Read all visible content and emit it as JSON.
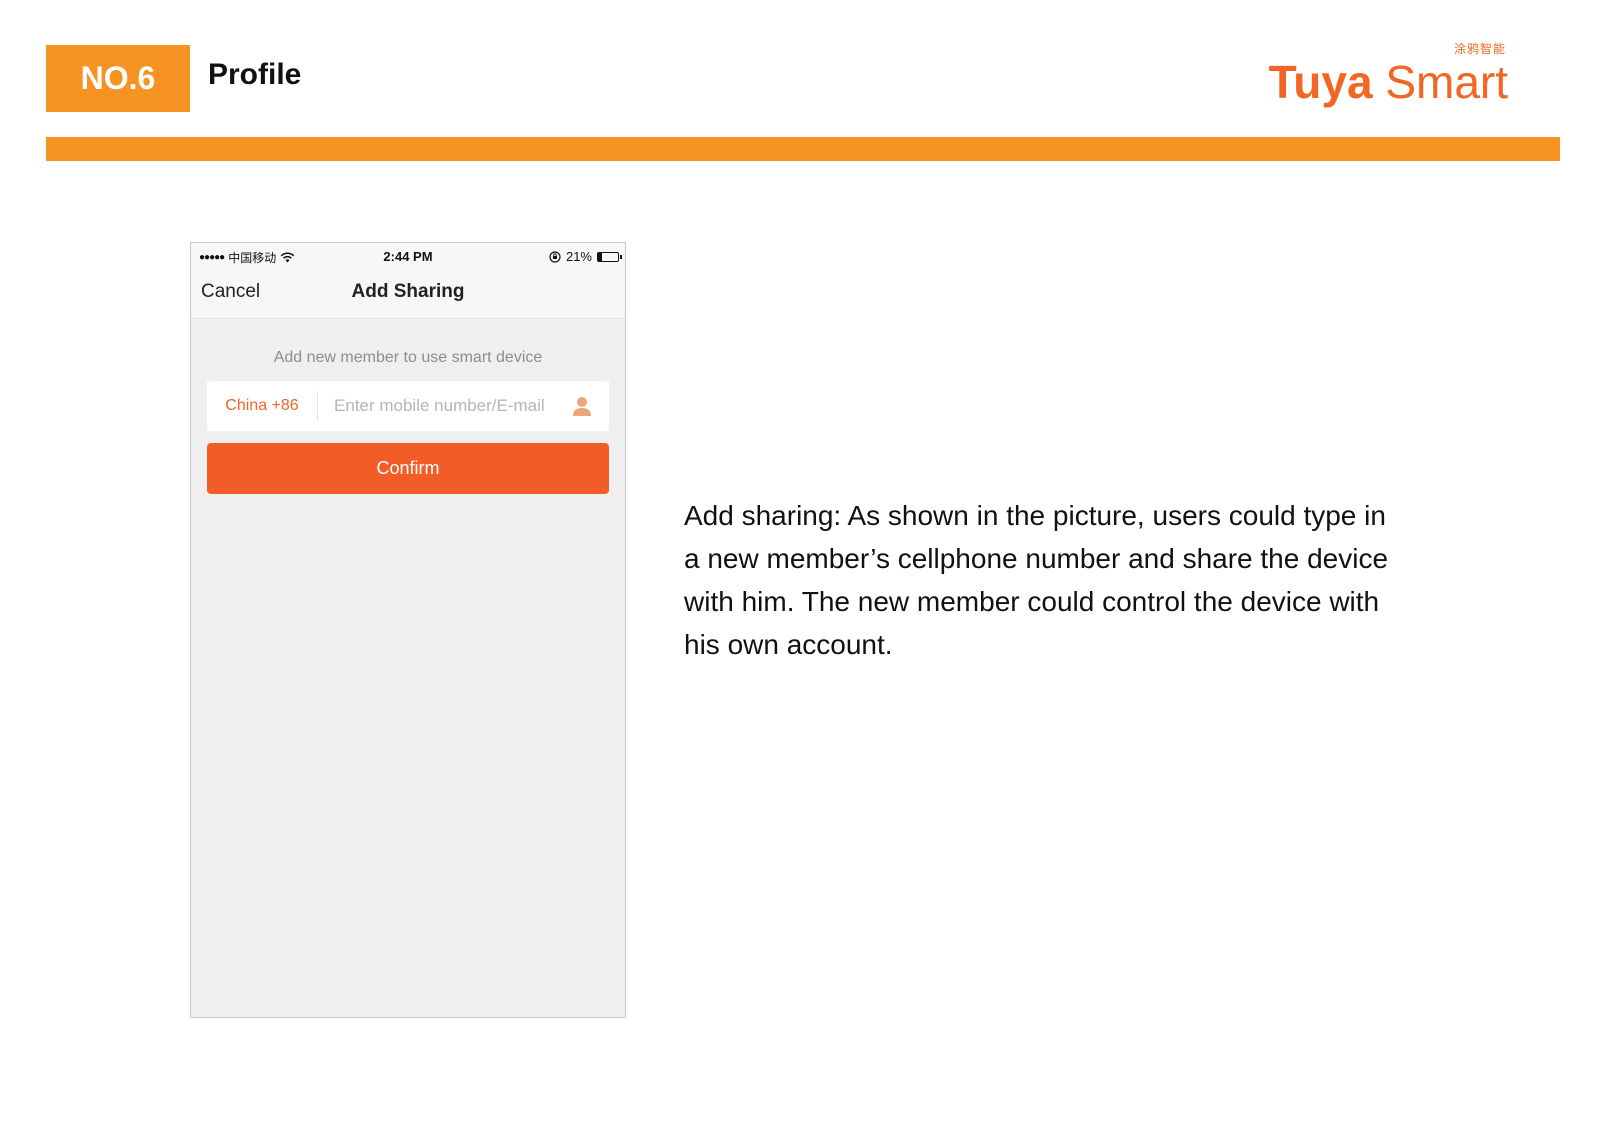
{
  "header": {
    "badge": "NO.6",
    "section_title": "Profile",
    "brand_cn": "涂鸦智能",
    "brand_name_bold": "Tuya",
    "brand_name_light": "Smart",
    "accent_color": "#f79322",
    "brand_color": "#f26522"
  },
  "phone": {
    "status_bar": {
      "signal": "●●●●●",
      "carrier": "中国移动",
      "wifi_icon": "wifi-icon",
      "time": "2:44 PM",
      "lock_icon": "rotation-lock-icon",
      "battery_percent": "21%",
      "battery_level": 0.21
    },
    "nav": {
      "cancel_label": "Cancel",
      "title": "Add Sharing"
    },
    "hint": "Add new member to use smart device",
    "country_code": "China +86",
    "input_placeholder": "Enter mobile number/E-mail",
    "input_value": "",
    "contact_icon": "user-icon",
    "confirm_label": "Confirm",
    "button_color": "#f25c26"
  },
  "description": "Add sharing: As shown in the picture, users could type in a new member’s cellphone number and share the device with him. The new member could control the device with his own account."
}
